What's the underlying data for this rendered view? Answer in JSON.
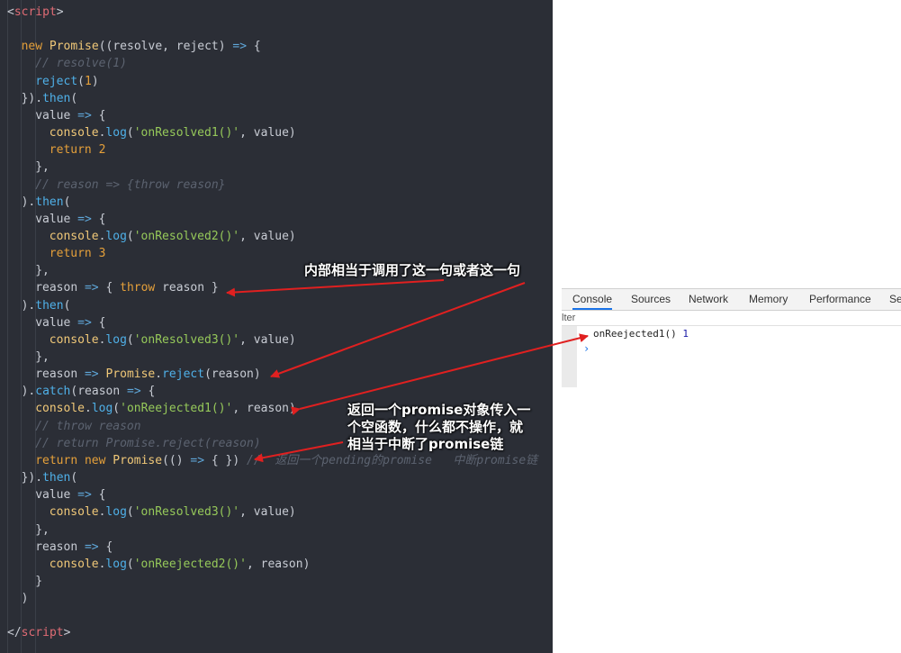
{
  "code_lines": [
    {
      "indent": 0,
      "tokens": [
        {
          "t": "<",
          "c": "pl"
        },
        {
          "t": "script",
          "c": "tag"
        },
        {
          "t": ">",
          "c": "pl"
        }
      ]
    },
    {
      "indent": 0,
      "tokens": []
    },
    {
      "indent": 2,
      "tokens": [
        {
          "t": "new ",
          "c": "kw"
        },
        {
          "t": "Promise",
          "c": "cls"
        },
        {
          "t": "((resolve, reject) ",
          "c": "pl"
        },
        {
          "t": "=>",
          "c": "arrow"
        },
        {
          "t": " {",
          "c": "pl"
        }
      ]
    },
    {
      "indent": 4,
      "tokens": [
        {
          "t": "// resolve(1)",
          "c": "cmt"
        }
      ]
    },
    {
      "indent": 4,
      "tokens": [
        {
          "t": "reject",
          "c": "fn"
        },
        {
          "t": "(",
          "c": "pl"
        },
        {
          "t": "1",
          "c": "num"
        },
        {
          "t": ")",
          "c": "pl"
        }
      ]
    },
    {
      "indent": 2,
      "tokens": [
        {
          "t": "}).",
          "c": "pl"
        },
        {
          "t": "then",
          "c": "fn"
        },
        {
          "t": "(",
          "c": "pl"
        }
      ]
    },
    {
      "indent": 4,
      "tokens": [
        {
          "t": "value ",
          "c": "pl"
        },
        {
          "t": "=>",
          "c": "arrow"
        },
        {
          "t": " {",
          "c": "pl"
        }
      ]
    },
    {
      "indent": 6,
      "tokens": [
        {
          "t": "console",
          "c": "cls"
        },
        {
          "t": ".",
          "c": "pl"
        },
        {
          "t": "log",
          "c": "fn"
        },
        {
          "t": "(",
          "c": "pl"
        },
        {
          "t": "'onResolved1()'",
          "c": "str"
        },
        {
          "t": ", value)",
          "c": "pl"
        }
      ]
    },
    {
      "indent": 6,
      "tokens": [
        {
          "t": "return ",
          "c": "kw"
        },
        {
          "t": "2",
          "c": "num"
        }
      ]
    },
    {
      "indent": 4,
      "tokens": [
        {
          "t": "},",
          "c": "pl"
        }
      ]
    },
    {
      "indent": 4,
      "tokens": [
        {
          "t": "// reason => {throw reason}",
          "c": "cmt"
        }
      ]
    },
    {
      "indent": 2,
      "tokens": [
        {
          "t": ").",
          "c": "pl"
        },
        {
          "t": "then",
          "c": "fn"
        },
        {
          "t": "(",
          "c": "pl"
        }
      ]
    },
    {
      "indent": 4,
      "tokens": [
        {
          "t": "value ",
          "c": "pl"
        },
        {
          "t": "=>",
          "c": "arrow"
        },
        {
          "t": " {",
          "c": "pl"
        }
      ]
    },
    {
      "indent": 6,
      "tokens": [
        {
          "t": "console",
          "c": "cls"
        },
        {
          "t": ".",
          "c": "pl"
        },
        {
          "t": "log",
          "c": "fn"
        },
        {
          "t": "(",
          "c": "pl"
        },
        {
          "t": "'onResolved2()'",
          "c": "str"
        },
        {
          "t": ", value)",
          "c": "pl"
        }
      ]
    },
    {
      "indent": 6,
      "tokens": [
        {
          "t": "return ",
          "c": "kw"
        },
        {
          "t": "3",
          "c": "num"
        }
      ]
    },
    {
      "indent": 4,
      "tokens": [
        {
          "t": "},",
          "c": "pl"
        }
      ]
    },
    {
      "indent": 4,
      "tokens": [
        {
          "t": "reason ",
          "c": "pl"
        },
        {
          "t": "=>",
          "c": "arrow"
        },
        {
          "t": " { ",
          "c": "pl"
        },
        {
          "t": "throw",
          "c": "kw"
        },
        {
          "t": " reason }",
          "c": "pl"
        }
      ]
    },
    {
      "indent": 2,
      "tokens": [
        {
          "t": ").",
          "c": "pl"
        },
        {
          "t": "then",
          "c": "fn"
        },
        {
          "t": "(",
          "c": "pl"
        }
      ]
    },
    {
      "indent": 4,
      "tokens": [
        {
          "t": "value ",
          "c": "pl"
        },
        {
          "t": "=>",
          "c": "arrow"
        },
        {
          "t": " {",
          "c": "pl"
        }
      ]
    },
    {
      "indent": 6,
      "tokens": [
        {
          "t": "console",
          "c": "cls"
        },
        {
          "t": ".",
          "c": "pl"
        },
        {
          "t": "log",
          "c": "fn"
        },
        {
          "t": "(",
          "c": "pl"
        },
        {
          "t": "'onResolved3()'",
          "c": "str"
        },
        {
          "t": ", value)",
          "c": "pl"
        }
      ]
    },
    {
      "indent": 4,
      "tokens": [
        {
          "t": "},",
          "c": "pl"
        }
      ]
    },
    {
      "indent": 4,
      "tokens": [
        {
          "t": "reason ",
          "c": "pl"
        },
        {
          "t": "=>",
          "c": "arrow"
        },
        {
          "t": " ",
          "c": "pl"
        },
        {
          "t": "Promise",
          "c": "cls"
        },
        {
          "t": ".",
          "c": "pl"
        },
        {
          "t": "reject",
          "c": "fn"
        },
        {
          "t": "(reason)",
          "c": "pl"
        }
      ]
    },
    {
      "indent": 2,
      "tokens": [
        {
          "t": ").",
          "c": "pl"
        },
        {
          "t": "catch",
          "c": "fn"
        },
        {
          "t": "(reason ",
          "c": "pl"
        },
        {
          "t": "=>",
          "c": "arrow"
        },
        {
          "t": " {",
          "c": "pl"
        }
      ]
    },
    {
      "indent": 4,
      "tokens": [
        {
          "t": "console",
          "c": "cls"
        },
        {
          "t": ".",
          "c": "pl"
        },
        {
          "t": "log",
          "c": "fn"
        },
        {
          "t": "(",
          "c": "pl"
        },
        {
          "t": "'onReejected1()'",
          "c": "str"
        },
        {
          "t": ", reason)",
          "c": "pl"
        }
      ]
    },
    {
      "indent": 4,
      "tokens": [
        {
          "t": "// throw reason",
          "c": "cmt"
        }
      ]
    },
    {
      "indent": 4,
      "tokens": [
        {
          "t": "// return Promise.reject(reason)",
          "c": "cmt"
        }
      ]
    },
    {
      "indent": 4,
      "tokens": [
        {
          "t": "return ",
          "c": "kw"
        },
        {
          "t": "new ",
          "c": "kw"
        },
        {
          "t": "Promise",
          "c": "cls"
        },
        {
          "t": "(() ",
          "c": "pl"
        },
        {
          "t": "=>",
          "c": "arrow"
        },
        {
          "t": " { }) ",
          "c": "pl"
        },
        {
          "t": "//  返回一个pending的promise   中断promise链",
          "c": "cmt"
        }
      ]
    },
    {
      "indent": 2,
      "tokens": [
        {
          "t": "}).",
          "c": "pl"
        },
        {
          "t": "then",
          "c": "fn"
        },
        {
          "t": "(",
          "c": "pl"
        }
      ]
    },
    {
      "indent": 4,
      "tokens": [
        {
          "t": "value ",
          "c": "pl"
        },
        {
          "t": "=>",
          "c": "arrow"
        },
        {
          "t": " {",
          "c": "pl"
        }
      ]
    },
    {
      "indent": 6,
      "tokens": [
        {
          "t": "console",
          "c": "cls"
        },
        {
          "t": ".",
          "c": "pl"
        },
        {
          "t": "log",
          "c": "fn"
        },
        {
          "t": "(",
          "c": "pl"
        },
        {
          "t": "'onResolved3()'",
          "c": "str"
        },
        {
          "t": ", value)",
          "c": "pl"
        }
      ]
    },
    {
      "indent": 4,
      "tokens": [
        {
          "t": "},",
          "c": "pl"
        }
      ]
    },
    {
      "indent": 4,
      "tokens": [
        {
          "t": "reason ",
          "c": "pl"
        },
        {
          "t": "=>",
          "c": "arrow"
        },
        {
          "t": " {",
          "c": "pl"
        }
      ]
    },
    {
      "indent": 6,
      "tokens": [
        {
          "t": "console",
          "c": "cls"
        },
        {
          "t": ".",
          "c": "pl"
        },
        {
          "t": "log",
          "c": "fn"
        },
        {
          "t": "(",
          "c": "pl"
        },
        {
          "t": "'onReejected2()'",
          "c": "str"
        },
        {
          "t": ", reason)",
          "c": "pl"
        }
      ]
    },
    {
      "indent": 4,
      "tokens": [
        {
          "t": "}",
          "c": "pl"
        }
      ]
    },
    {
      "indent": 2,
      "tokens": [
        {
          "t": ")",
          "c": "pl"
        }
      ]
    },
    {
      "indent": 0,
      "tokens": []
    },
    {
      "indent": 0,
      "tokens": [
        {
          "t": "</",
          "c": "pl"
        },
        {
          "t": "script",
          "c": "tag"
        },
        {
          "t": ">",
          "c": "pl"
        }
      ]
    }
  ],
  "annotations": {
    "top": "内部相当于调用了这一句或者这一句",
    "bottom_line1": "返回一个promise对象传入一",
    "bottom_line2": "个空函数，什么都不操作，就",
    "bottom_line3": "相当于中断了promise链"
  },
  "devtools": {
    "tabs": [
      "Console",
      "Sources",
      "Network",
      "Memory",
      "Performance",
      "Se"
    ],
    "active_tab": "Console",
    "filter_text": "lter",
    "log_text": "onReejected1()",
    "log_value": "1",
    "prompt": "›"
  },
  "colors": {
    "editor_bg": "#2b2e36",
    "arrow_red": "#e02020",
    "active_tab": "#1a73e8"
  }
}
